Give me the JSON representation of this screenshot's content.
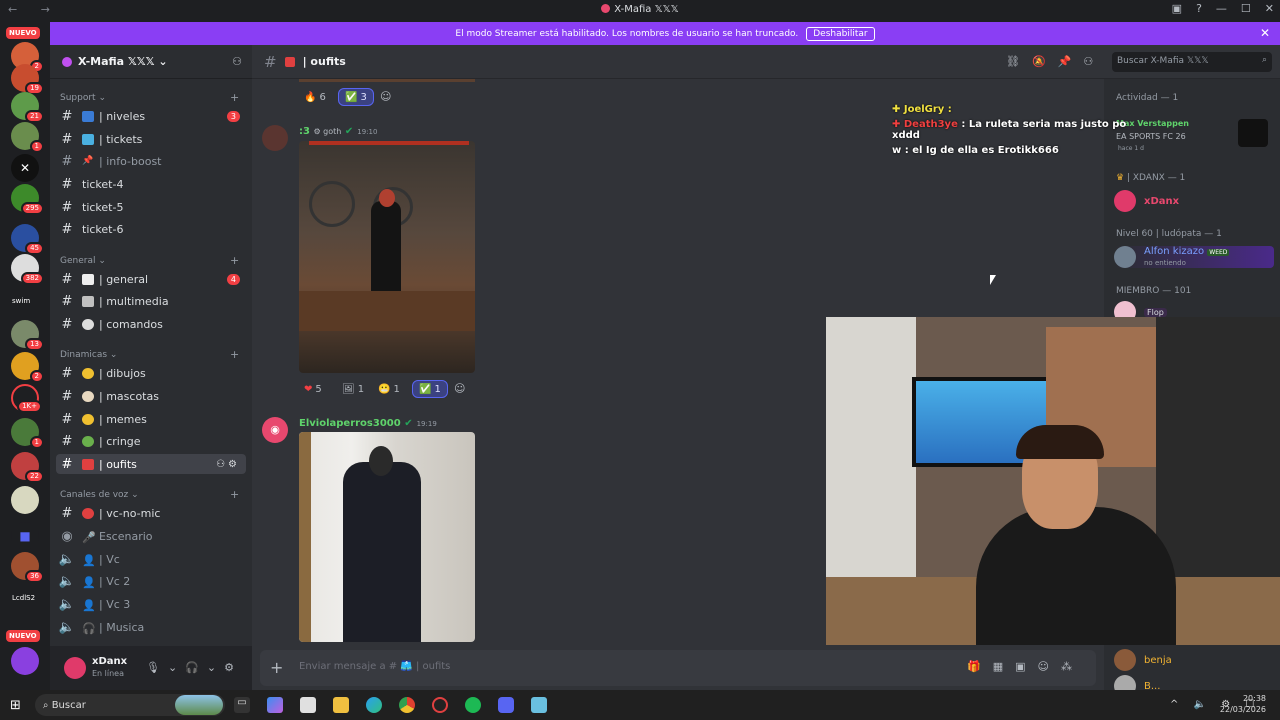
{
  "window": {
    "title": "X-Mafia 𝕏𝕏𝕏",
    "nav": "← →"
  },
  "banner": {
    "text": "El modo Streamer está habilitado. Los nombres de usuario se han truncado.",
    "button": "Deshabilitar"
  },
  "server_rail": {
    "nuevo_top": "NUEVO",
    "nuevo_bottom": "NUEVO",
    "badges": [
      "2",
      "19",
      "21",
      "1",
      "295",
      "45",
      "382",
      "13",
      "2",
      "1K+",
      "1",
      "22",
      "36"
    ],
    "labels": [
      "swim",
      "LcdlS2"
    ]
  },
  "guild": {
    "name": "X-Mafia 𝕏𝕏𝕏 ⌄"
  },
  "categories": {
    "support": "Support ⌄",
    "general": "General ⌄",
    "dinamicas": "Dinamicas ⌄",
    "voz": "Canales de voz ⌄"
  },
  "channels": {
    "niveles": "| niveles",
    "niveles_badge": "3",
    "tickets": "| tickets",
    "info_boost": "| info-boost",
    "ticket4": "ticket-4",
    "ticket5": "ticket-5",
    "ticket6": "ticket-6",
    "general": "| general",
    "general_badge": "4",
    "multimedia": "| multimedia",
    "comandos": "| comandos",
    "dibujos": "| dibujos",
    "mascotas": "| mascotas",
    "memes": "| memes",
    "cringe": "| cringe",
    "oufits": "| oufits",
    "vc_no_mic": "| vc-no-mic",
    "escenario": "Escenario",
    "vc": "| Vc",
    "vc2": "| Vc 2",
    "vc3": "| Vc 3",
    "musica": "| Musica"
  },
  "user": {
    "name": "xDanx",
    "status": "En línea"
  },
  "channel_header": {
    "name": "| oufits"
  },
  "search": {
    "placeholder": "Buscar X-Mafia 𝕏𝕏𝕏"
  },
  "messages": {
    "top_reactions": [
      {
        "emoji": "🔥",
        "count": "6"
      },
      {
        "emoji": "✅",
        "count": "3"
      }
    ],
    "msg1": {
      "author": ":3",
      "tag": "goth",
      "time": "19:10"
    },
    "msg1_reactions": [
      {
        "emoji": "❤",
        "count": "5"
      },
      {
        "emoji": "🖼",
        "count": "1"
      },
      {
        "emoji": "😬",
        "count": "1"
      },
      {
        "emoji": "✅",
        "count": "1"
      }
    ],
    "msg2": {
      "author": "Elviolaperros3000",
      "time": "19:19"
    }
  },
  "composer": {
    "placeholder": "Enviar mensaje a # 🩳 | oufits"
  },
  "stream_overlay": {
    "line1": "✚ JoelGry :",
    "line2_name": "✚ Death3ye",
    "line2_text": ": La ruleta seria mas justo po xddd",
    "line3": "w : el Ig de ella es Erotikk666"
  },
  "members": {
    "activity": "Actividad — 1",
    "activity_user": "Max Verstappen",
    "activity_game": "EA SPORTS FC 26",
    "activity_time": "hace 1 d",
    "role1": "| XDANX — 1",
    "role1_user": "xDanx",
    "role2": "Nivel 60 | ludópata — 1",
    "role2_user": "Alfon kizazo",
    "role2_tag": "WEED",
    "role2_status": "no entiendo",
    "role3": "MIEMBRO — 101",
    "role3_user": "Flop",
    "bottom_user1": "benja",
    "bottom_user2": "B..."
  },
  "taskbar": {
    "search": "Buscar",
    "time": "20:38",
    "date": "22/03/2026"
  }
}
